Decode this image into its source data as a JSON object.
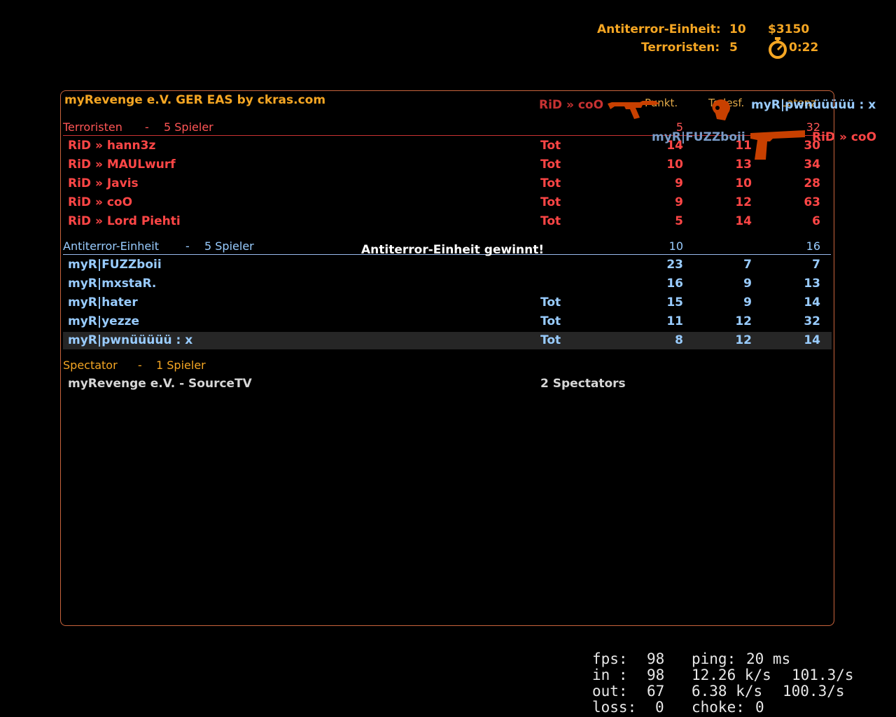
{
  "hud": {
    "ct_label": "Antiterror-Einheit:",
    "ct_score": "10",
    "t_label": "Terroristen:",
    "t_score": "5",
    "money": "$3150",
    "timer": "0:22",
    "timer_icon": "stopwatch-icon"
  },
  "scoreboard": {
    "server_name": "myRevenge e.V. GER EAS by ckras.com",
    "headers": {
      "score": "Punkt.",
      "deaths": "Todesf.",
      "latency": "Latenz"
    },
    "terrorists": {
      "label": "Terroristen",
      "sep": "-",
      "count": "5 Spieler",
      "score": "5",
      "latency": "32",
      "players": [
        {
          "name": "RiD » hann3z",
          "status": "Tot",
          "score": "14",
          "deaths": "11",
          "latency": "30"
        },
        {
          "name": "RiD » MAULwurf",
          "status": "Tot",
          "score": "10",
          "deaths": "13",
          "latency": "34"
        },
        {
          "name": "RiD » Javis",
          "status": "Tot",
          "score": "9",
          "deaths": "10",
          "latency": "28"
        },
        {
          "name": "RiD » coO",
          "status": "Tot",
          "score": "9",
          "deaths": "12",
          "latency": "63"
        },
        {
          "name": "RiD » Lord Piehti",
          "status": "Tot",
          "score": "5",
          "deaths": "14",
          "latency": "6"
        }
      ]
    },
    "ct": {
      "label": "Antiterror-Einheit",
      "sep": "-",
      "count": "5 Spieler",
      "score": "10",
      "latency": "16",
      "players": [
        {
          "name": "myR|FUZZboii",
          "status": "",
          "score": "23",
          "deaths": "7",
          "latency": "7"
        },
        {
          "name": "myR|mxstaR.",
          "status": "",
          "score": "16",
          "deaths": "9",
          "latency": "13"
        },
        {
          "name": "myR|hater",
          "status": "Tot",
          "score": "15",
          "deaths": "9",
          "latency": "14"
        },
        {
          "name": "myR|yezze",
          "status": "Tot",
          "score": "11",
          "deaths": "12",
          "latency": "32"
        },
        {
          "name": "myR|pwnüüüüü : x",
          "status": "Tot",
          "score": "8",
          "deaths": "12",
          "latency": "14"
        }
      ]
    },
    "spectators": {
      "label": "Spectator",
      "sep": "-",
      "count": "1 Spieler",
      "players": [
        {
          "name": "myRevenge e.V. - SourceTV",
          "status": "2 Spectators"
        }
      ]
    }
  },
  "round_message": "Antiterror-Einheit gewinnt!",
  "killfeed": [
    {
      "killer": "RiD » coO",
      "weapon": "ak47-icon",
      "headshot": "headshot-icon",
      "victim": "myR|pwnüüüüü : x"
    },
    {
      "killer": "myR|FUZZboii",
      "weapon": "deagle-icon",
      "victim": "RiD » coO"
    }
  ],
  "net_graph": {
    "fps_label": "fps:",
    "fps": "98",
    "ping_label": "ping:",
    "ping": "20 ms",
    "in_label": "in :",
    "in": "98",
    "in_rate": "12.26 k/s",
    "in_rate2": "101.3/s",
    "out_label": "out:",
    "out": "67",
    "out_rate": "6.38 k/s",
    "out_rate2": "100.3/s",
    "loss_label": "loss:",
    "loss": "0",
    "choke_label": "choke:",
    "choke": "0"
  },
  "colors": {
    "t": "#ff4646",
    "ct": "#99ccff",
    "hud": "#f5a623",
    "weapon": "#c84000"
  }
}
